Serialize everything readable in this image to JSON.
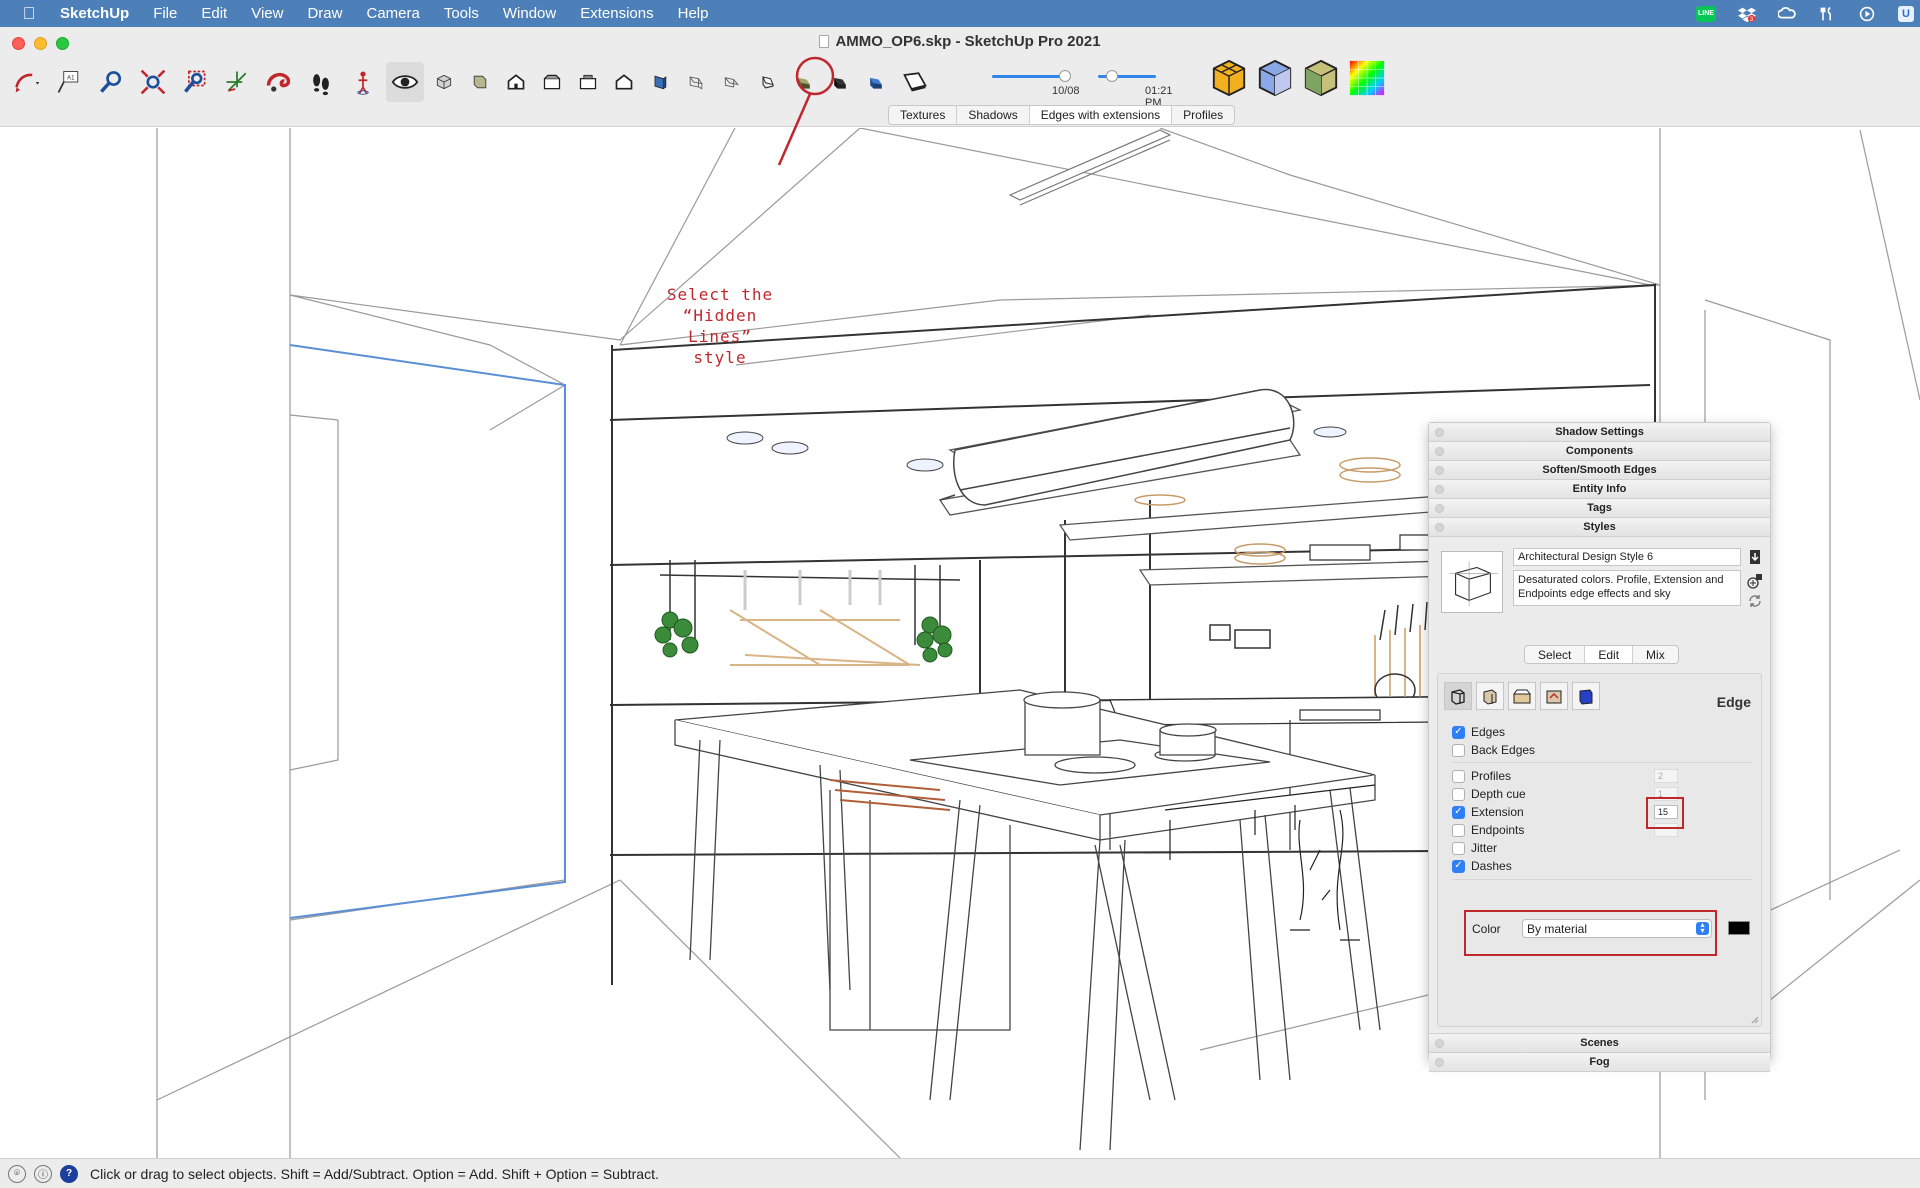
{
  "menubar": {
    "apple_icon": "apple-icon",
    "app_name": "SketchUp",
    "items": [
      "File",
      "Edit",
      "View",
      "Draw",
      "Camera",
      "Tools",
      "Window",
      "Extensions",
      "Help"
    ],
    "tray_line_label": "LINE",
    "tray_dropbox_badge": "3",
    "tray_user_label": "U"
  },
  "window": {
    "title": "AMMO_OP6.skp - SketchUp Pro 2021"
  },
  "toolbar": {
    "tools": [
      "select-arrow-icon",
      "text-label-icon",
      "zoom-icon",
      "zoom-extents-icon",
      "zoom-window-icon",
      "axes-icon",
      "solid-tools-icon",
      "walk-icon",
      "position-camera-icon",
      "look-around-icon",
      "xray-icon",
      "back-edges-icon",
      "iso-view-icon",
      "top-view-icon",
      "front-view-icon",
      "right-view-icon",
      "back-view-icon",
      "left-view-icon",
      "wireframe-icon",
      "hidden-line-icon",
      "shaded-icon",
      "shaded-textures-icon",
      "monochrome-icon",
      "section-plane-icon"
    ],
    "text_label_glyph": "A1",
    "date_label": "10/08",
    "time_label": "01:21 PM",
    "date_position": 0.35,
    "time_position": 0.6
  },
  "scene_tabs": [
    "Textures",
    "Shadows",
    "Edges with extensions",
    "Profiles"
  ],
  "selected_scene_tab": "Edges with extensions",
  "callout": {
    "line1": "Select the",
    "line2": "“Hidden Lines”",
    "line3": "style",
    "color": "#c0272d"
  },
  "tray": {
    "sections_top": [
      "Shadow Settings",
      "Components",
      "Soften/Smooth Edges",
      "Entity Info",
      "Tags",
      "Styles"
    ],
    "sections_bottom": [
      "Scenes",
      "Fog"
    ],
    "style_name": "Architectural Design Style 6",
    "style_description": "Desaturated colors. Profile, Extension and Endpoints edge effects and sky",
    "sub_tabs": [
      "Select",
      "Edit",
      "Mix"
    ],
    "selected_sub_tab": "Edit",
    "category_title": "Edge",
    "options": {
      "edges": {
        "label": "Edges",
        "checked": true
      },
      "back_edges": {
        "label": "Back Edges",
        "checked": false
      },
      "profiles": {
        "label": "Profiles",
        "checked": false,
        "value": "2"
      },
      "depth_cue": {
        "label": "Depth cue",
        "checked": false,
        "value": "1"
      },
      "extension": {
        "label": "Extension",
        "checked": true,
        "value": "15"
      },
      "endpoints": {
        "label": "Endpoints",
        "checked": false
      },
      "jitter": {
        "label": "Jitter",
        "checked": false
      },
      "dashes": {
        "label": "Dashes",
        "checked": true
      }
    },
    "color_label": "Color",
    "color_value": "By material",
    "color_swatch": "#000000"
  },
  "status": {
    "text": "Click or drag to select objects. Shift = Add/Subtract. Option = Add. Shift + Option = Subtract."
  },
  "colors": {
    "menubar": "#4d80b8",
    "accent_blue": "#2f7ff6",
    "highlight_red": "#c0272d",
    "selection_blue": "#5a8fd8"
  }
}
